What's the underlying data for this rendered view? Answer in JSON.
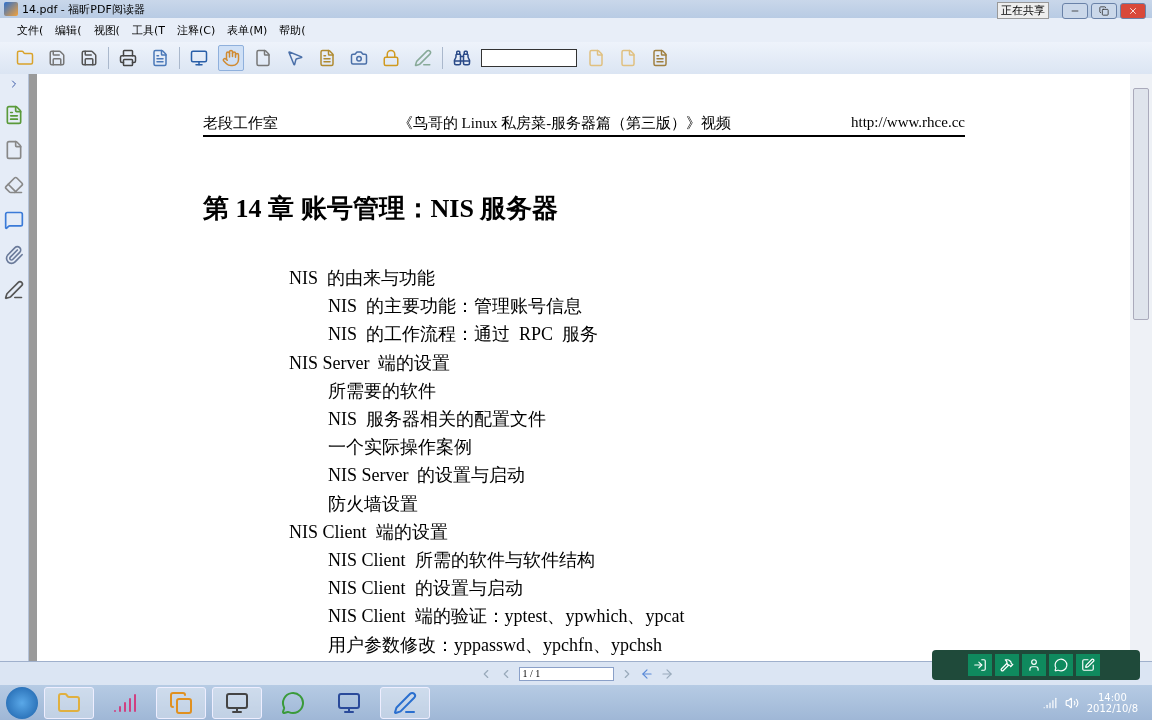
{
  "window": {
    "title": "14.pdf - 福昕PDF阅读器",
    "sharing_label": "正在共享"
  },
  "menu": [
    "文件(",
    "编辑(",
    "视图(",
    "工具(T",
    "注释(C)",
    "表单(M)",
    "帮助("
  ],
  "document": {
    "header_left": "老段工作室",
    "header_center": "《鸟哥的 Linux 私房菜-服务器篇（第三版）》视频",
    "header_right": "http://www.rhce.cc",
    "chapter_title": "第 14 章  账号管理：NIS  服务器",
    "outline": [
      {
        "text": "NIS  的由来与功能",
        "children": [
          {
            "text": "NIS  的主要功能：管理账号信息"
          },
          {
            "text": "NIS  的工作流程：通过  RPC  服务"
          }
        ]
      },
      {
        "text": "NIS Server  端的设置",
        "children": [
          {
            "text": "所需要的软件"
          },
          {
            "text": "NIS  服务器相关的配置文件"
          },
          {
            "text": "一个实际操作案例"
          },
          {
            "text": "NIS Server  的设置与启动"
          },
          {
            "text": "防火墙设置"
          }
        ]
      },
      {
        "text": "NIS Client  端的设置",
        "children": [
          {
            "text": "NIS Client  所需的软件与软件结构"
          },
          {
            "text": "NIS Client  的设置与启动"
          },
          {
            "text": "NIS Client  端的验证：yptest、ypwhich、ypcat"
          },
          {
            "text": "用户参数修改：yppasswd、ypchfn、ypchsh"
          }
        ]
      }
    ]
  },
  "status_bar": {
    "page": "1 / 1"
  },
  "taskbar": {
    "time": "14:00",
    "date": "2012/10/8"
  }
}
